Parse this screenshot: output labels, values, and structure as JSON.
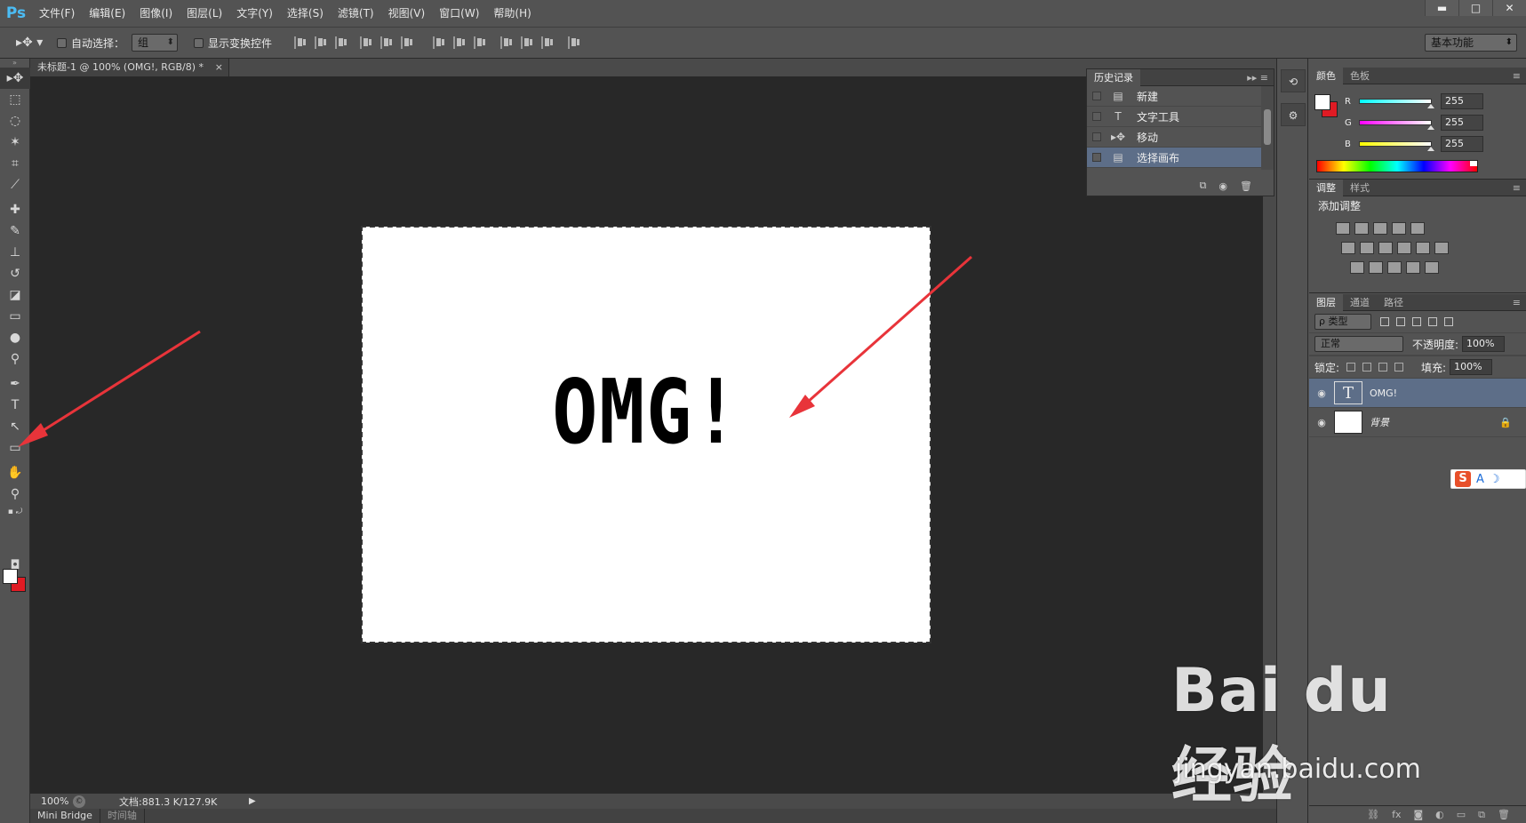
{
  "app": {
    "logo": "Ps"
  },
  "menu": [
    "文件(F)",
    "编辑(E)",
    "图像(I)",
    "图层(L)",
    "文字(Y)",
    "选择(S)",
    "滤镜(T)",
    "视图(V)",
    "窗口(W)",
    "帮助(H)"
  ],
  "window_controls": {
    "minimize": "▬",
    "restore": "□",
    "close": "✕"
  },
  "options_bar": {
    "auto_select_label": "自动选择：",
    "auto_select_value": "组",
    "show_transform_label": "显示变换控件",
    "workspace": "基本功能"
  },
  "document": {
    "tab_title": "未标题-1 @ 100% (OMG!, RGB/8) *",
    "tab_close": "×",
    "canvas_text": "OMG!",
    "zoom": "100%",
    "doc_info": "文档:881.3 K/127.9K"
  },
  "bottom_tabs": [
    "Mini Bridge",
    "时间轴"
  ],
  "history": {
    "tab": "历史记录",
    "items": [
      {
        "label": "新建",
        "icon": "document-icon"
      },
      {
        "label": "文字工具",
        "icon": "type-tool-icon"
      },
      {
        "label": "移动",
        "icon": "move-tool-icon"
      },
      {
        "label": "选择画布",
        "icon": "document-icon",
        "selected": true
      }
    ]
  },
  "color_panel": {
    "tabs": [
      "颜色",
      "色板"
    ],
    "r_label": "R",
    "g_label": "G",
    "b_label": "B",
    "r": "255",
    "g": "255",
    "b": "255",
    "foreground": "#ffffff",
    "background": "#e01b24"
  },
  "adjustments": {
    "tabs": [
      "调整",
      "样式"
    ],
    "title": "添加调整"
  },
  "layers": {
    "tabs": [
      "图层",
      "通道",
      "路径"
    ],
    "kind": "ρ 类型",
    "blend_mode": "正常",
    "opacity_label": "不透明度:",
    "opacity": "100%",
    "lock_label": "锁定:",
    "fill_label": "填充:",
    "fill": "100%",
    "items": [
      {
        "name": "OMG!",
        "type": "text",
        "selected": true
      },
      {
        "name": "背景",
        "type": "background",
        "locked": true
      }
    ]
  },
  "ime": {
    "s": "S",
    "a": "A",
    "moon": "☽"
  },
  "watermark": {
    "brand": "Bai du 经验",
    "url": "jingyan.baidu.com"
  },
  "colors": {
    "accent": "#4bbcf4",
    "selection": "#5d6e88",
    "arrow": "#e8343a"
  }
}
